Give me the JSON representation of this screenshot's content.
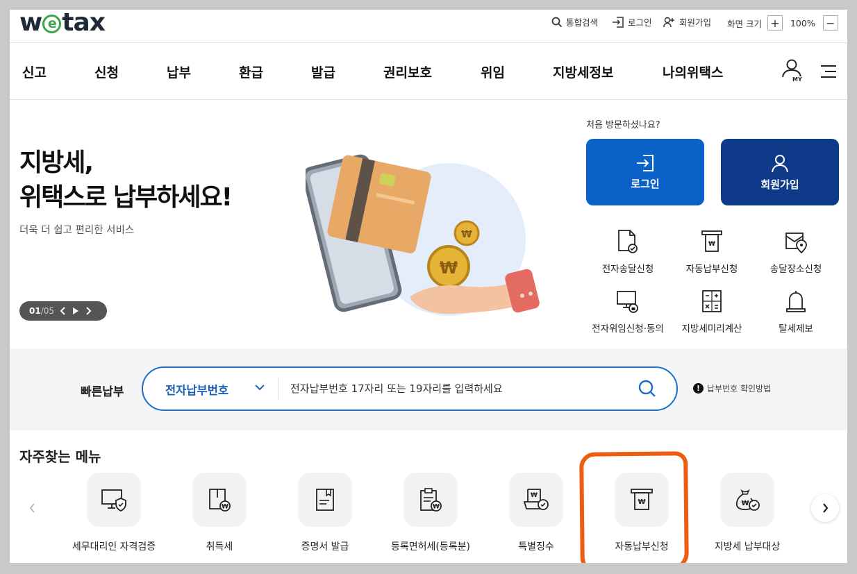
{
  "header": {
    "logo_text": "wetax",
    "util": {
      "search": "통합검색",
      "login": "로그인",
      "signup": "회원가입",
      "screen_size_label": "화면 크기",
      "zoom_in": "+",
      "zoom_level": "100%",
      "zoom_out": "−"
    }
  },
  "nav": {
    "items": [
      "신고",
      "신청",
      "납부",
      "환급",
      "발급",
      "권리보호",
      "위임",
      "지방세정보",
      "나의위택스"
    ],
    "my_label": "MY"
  },
  "hero": {
    "title_line1": "지방세,",
    "title_line2": "위택스로 납부하세요!",
    "subtitle": "더욱 더 쉽고 편리한 서비스",
    "pager_current": "01",
    "pager_sep": "/",
    "pager_total": "05"
  },
  "side": {
    "visit_question": "처음 방문하셨나요?",
    "login_button": "로그인",
    "signup_button": "회원가입",
    "quick_links": [
      "전자송달신청",
      "자동납부신청",
      "송달장소신청",
      "전자위임신청·동의",
      "지방세미리계산",
      "탈세제보"
    ]
  },
  "quickpay": {
    "label": "빠른납부",
    "select_value": "전자납부번호",
    "placeholder": "전자납부번호 17자리 또는 19자리를 입력하세요",
    "help": "납부번호 확인방법"
  },
  "frequent": {
    "title": "자주찾는 메뉴",
    "items": [
      "세무대리인 자격검증",
      "취득세",
      "증명서 발급",
      "등록면허세(등록분)",
      "특별징수",
      "자동납부신청",
      "지방세 납부대상"
    ]
  },
  "colors": {
    "primary_blue": "#0a62c9",
    "dark_blue": "#0f3a8a",
    "highlight": "#ec5d12"
  }
}
